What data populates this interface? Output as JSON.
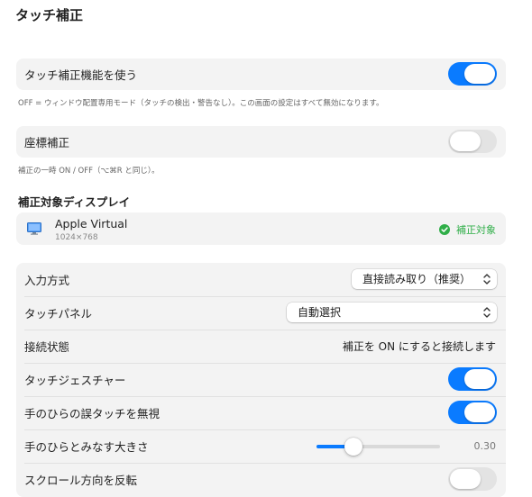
{
  "page_title": "タッチ補正",
  "touch_feature": {
    "label": "タッチ補正機能を使う",
    "enabled": true,
    "note": "OFF = ウィンドウ配置専用モード（タッチの検出・警告なし）。この画面の設定はすべて無効になります。"
  },
  "coordinate": {
    "label": "座標補正",
    "enabled": false,
    "note": "補正の一時 ON / OFF（⌥⌘R と同じ）。"
  },
  "display_section": {
    "heading": "補正対象ディスプレイ",
    "display_name": "Apple Virtual",
    "display_resolution": "1024×768",
    "status_text": "補正対象",
    "status_color": "#2fae48"
  },
  "settings": {
    "input_method": {
      "label": "入力方式",
      "value": "直接読み取り（推奨）"
    },
    "touch_panel": {
      "label": "タッチパネル",
      "value": "自動選択"
    },
    "connection": {
      "label": "接続状態",
      "value": "補正を ON にすると接続します"
    },
    "gesture": {
      "label": "タッチジェスチャー",
      "enabled": true
    },
    "palm_reject": {
      "label": "手のひらの誤タッチを無視",
      "enabled": true
    },
    "palm_size": {
      "label": "手のひらとみなす大きさ",
      "value": 0.3,
      "value_text": "0.30"
    },
    "scroll_reverse": {
      "label": "スクロール方向を反転",
      "enabled": false
    }
  },
  "colors": {
    "accent": "#0a7bff",
    "card_bg": "#f3f3f3",
    "status_green": "#2fae48"
  }
}
